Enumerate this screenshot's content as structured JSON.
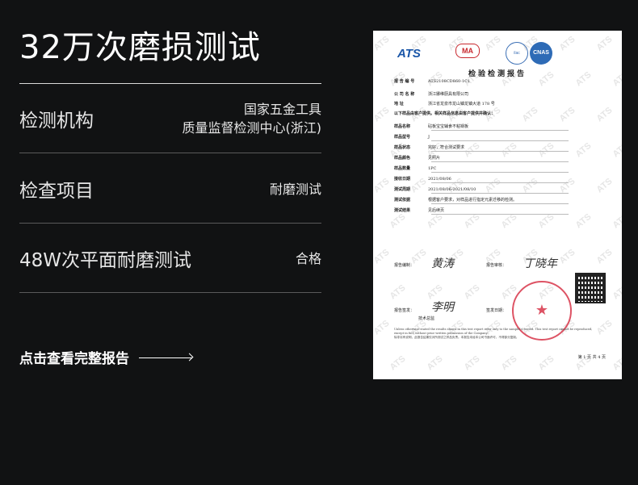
{
  "header": {
    "title": "32万次磨损测试"
  },
  "rows": [
    {
      "key": "检测机构",
      "value_lines": [
        "国家五金工具",
        "质量监督检测中心(浙江)"
      ]
    },
    {
      "key": "检查项目",
      "value_lines": [
        "耐磨测试"
      ]
    },
    {
      "key": "48W次平面耐磨测试",
      "value_lines": [
        "合格"
      ]
    }
  ],
  "cta": {
    "label": "点击查看完整报告"
  },
  "certificate": {
    "title": "检验检测报告",
    "logo_text": "ATS",
    "ma_text": "MA",
    "cnas_text": "CNAS",
    "report_no_label": "报 告 编 号",
    "report_no": "ATS2108CD860-1C1",
    "company_label": "公 司 名 称",
    "company": "浙江娜维厨具有限公司",
    "address_label": "地 址",
    "address": "浙江省龙泉市龙山镇龙镇大道 178 号",
    "note": "以下样品由客户提供。相关样品信息由客户提供并确认：",
    "fields": [
      {
        "label": "样品名称",
        "value": "砧板宝宝辅食不粘锅板"
      },
      {
        "label": "样品型号",
        "value": "J"
      },
      {
        "label": "样品状态",
        "value": "完好，符合测试要求"
      },
      {
        "label": "样品颜色",
        "value": "见照片"
      },
      {
        "label": "样品数量",
        "value": "1PC"
      },
      {
        "label": "接收日期",
        "value": "2021/08/06"
      },
      {
        "label": "测试周期",
        "value": "2021/08/06-2021/08/10"
      },
      {
        "label": "测试依据",
        "value": "根据客户要求，对样品进行指定元素迁移的检测。"
      },
      {
        "label": "测试结果",
        "value": "见后续页"
      }
    ],
    "compiled_label": "报告编制：",
    "reviewed_label": "报告审核：",
    "approved_label": "报告签发：",
    "issue_date_label": "签发日期：",
    "tech_lead": "技术总监",
    "sig_1": "黄涛",
    "sig_2": "丁晓年",
    "sig_3": "李明",
    "stamp_text": "★",
    "fine_print_en": "Unless otherwise stated the results shown in this test report refer only to the sample(s) tested. This test report cannot be reproduced, except in full, without prior written permission of the Company.",
    "fine_print_cn": "除非另有说明，此报告结果仅对所测试之样品负责。本报告未经本公司书面许可，不得部分复制。",
    "page_no": "第 1 页 共 4 页"
  }
}
